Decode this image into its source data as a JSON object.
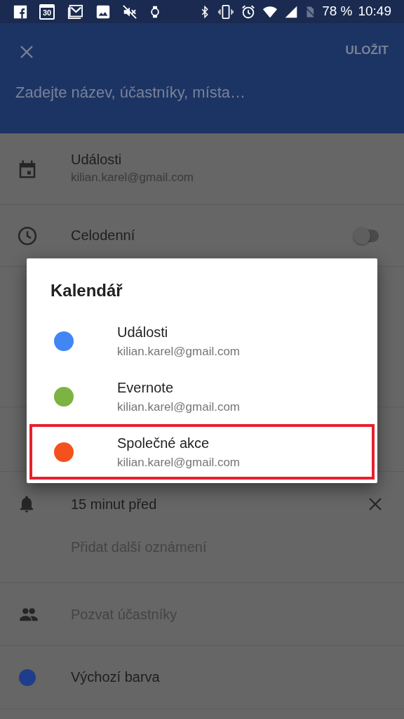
{
  "status_bar": {
    "calendar_day": "30",
    "battery": "78 %",
    "time": "10:49"
  },
  "app_bar": {
    "save": "ULOŽIT",
    "title_placeholder": "Zadejte název, účastníky, místa…"
  },
  "calendar_row": {
    "name": "Události",
    "account": "kilian.karel@gmail.com"
  },
  "all_day": {
    "label": "Celodenní",
    "on": false
  },
  "reminder": {
    "label": "15 minut před",
    "add": "Přidat další oznámení"
  },
  "invite": {
    "placeholder": "Pozvat účastníky"
  },
  "event_color": {
    "label": "Výchozí barva",
    "color": "#1f3d8a"
  },
  "dialog": {
    "title": "Kalendář",
    "items": [
      {
        "name": "Události",
        "account": "kilian.karel@gmail.com",
        "color": "#4285f4",
        "highlighted": false
      },
      {
        "name": "Evernote",
        "account": "kilian.karel@gmail.com",
        "color": "#7cb342",
        "highlighted": false
      },
      {
        "name": "Společné akce",
        "account": "kilian.karel@gmail.com",
        "color": "#f4511e",
        "highlighted": true
      }
    ]
  }
}
